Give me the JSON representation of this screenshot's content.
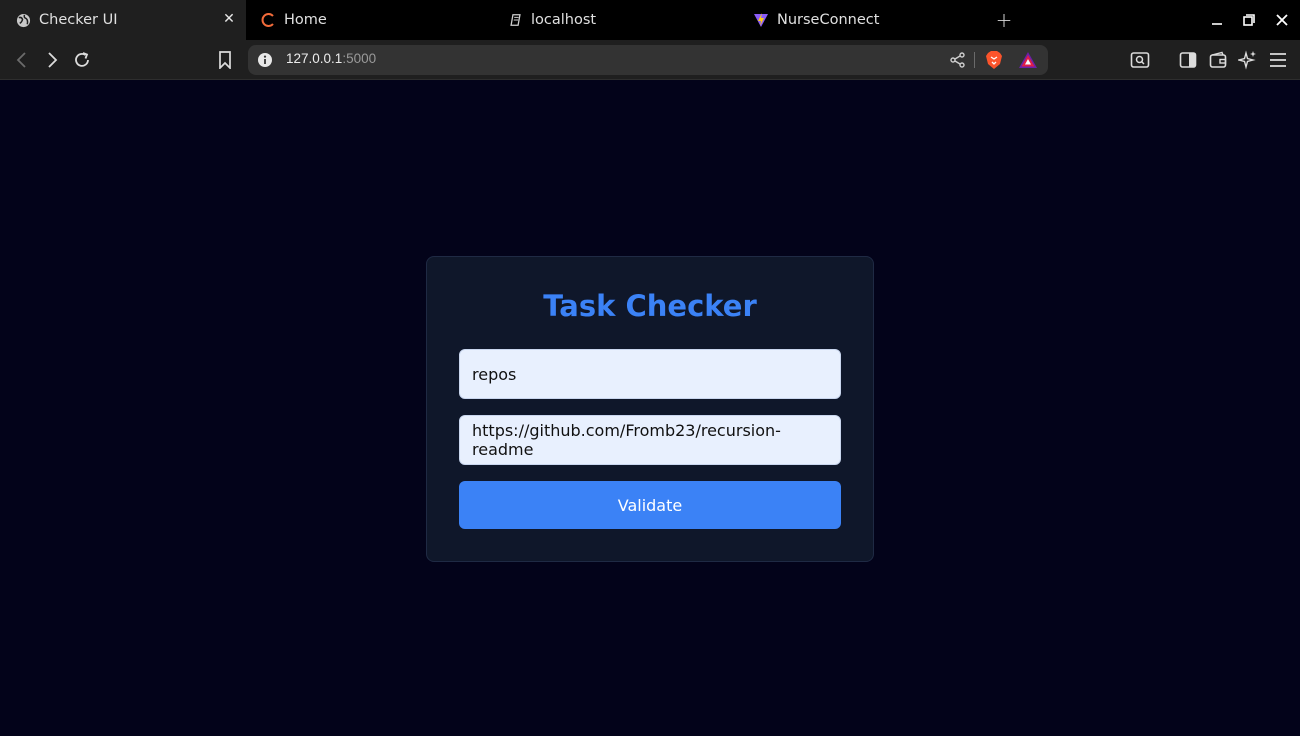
{
  "browser": {
    "tabs": [
      {
        "title": "Checker UI",
        "icon": "globe-icon",
        "active": true
      },
      {
        "title": "Home",
        "icon": "arc-logo-icon",
        "active": false
      },
      {
        "title": "localhost",
        "icon": "document-icon",
        "active": false
      },
      {
        "title": "NurseConnect",
        "icon": "vite-logo-icon",
        "active": false
      }
    ],
    "url": {
      "host": "127.0.0.1",
      "port": ":5000"
    }
  },
  "app": {
    "title": "Task Checker",
    "field_1_value": "repos",
    "field_2_value": "https://github.com/Fromb23/recursion-readme",
    "validate_label": "Validate"
  },
  "colors": {
    "page_bg": "#03031a",
    "card_bg": "#0f172a",
    "accent": "#3b82f6",
    "input_bg": "#e8f0fe"
  }
}
